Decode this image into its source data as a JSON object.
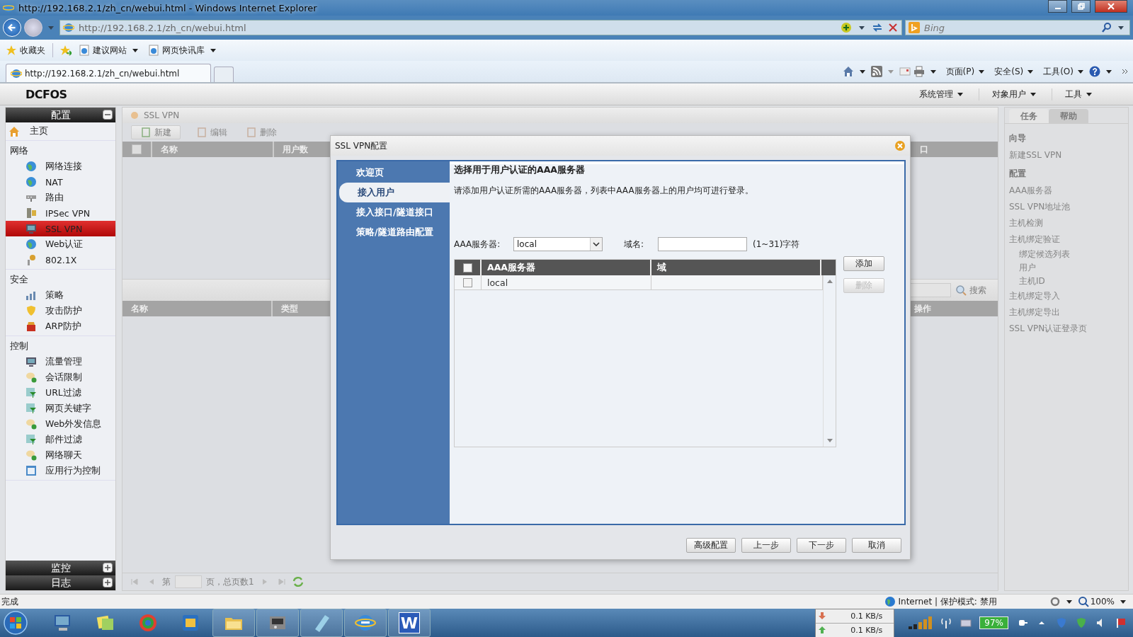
{
  "window": {
    "title": "http://192.168.2.1/zh_cn/webui.html - Windows Internet Explorer"
  },
  "address_bar": {
    "url": "http://192.168.2.1/zh_cn/webui.html"
  },
  "search_box": {
    "placeholder": "Bing"
  },
  "favorites_bar": {
    "items": [
      {
        "label": "收藏夹",
        "kind": "star"
      },
      {
        "label": "建议网站",
        "kind": "dropdown"
      },
      {
        "label": "网页快讯库",
        "kind": "dropdown"
      }
    ]
  },
  "browser_tabs": [
    {
      "label": "http://192.168.2.1/zh_cn/webui.html",
      "selected": true
    }
  ],
  "command_bar": {
    "menus": [
      "页面(P)",
      "安全(S)",
      "工具(O)"
    ]
  },
  "app": {
    "logo": "DCFOS",
    "menus": [
      "系统管理",
      "对象用户",
      "工具"
    ]
  },
  "sidebar": {
    "config_panel": {
      "title": "配置",
      "expanded": true,
      "home": {
        "label": "主页",
        "selected": false
      },
      "groups": [
        {
          "title": "网络",
          "items": [
            {
              "label": "网络连接",
              "selected": false
            },
            {
              "label": "NAT",
              "selected": false
            },
            {
              "label": "路由",
              "selected": false
            },
            {
              "label": "IPSec VPN",
              "selected": false
            },
            {
              "label": "SSL VPN",
              "selected": true
            },
            {
              "label": "Web认证",
              "selected": false
            },
            {
              "label": "802.1X",
              "selected": false
            }
          ]
        },
        {
          "title": "安全",
          "items": [
            {
              "label": "策略",
              "selected": false
            },
            {
              "label": "攻击防护",
              "selected": false
            },
            {
              "label": "ARP防护",
              "selected": false
            }
          ]
        },
        {
          "title": "控制",
          "items": [
            {
              "label": "流量管理",
              "selected": false
            },
            {
              "label": "会话限制",
              "selected": false
            },
            {
              "label": "URL过滤",
              "selected": false
            },
            {
              "label": "网页关键字",
              "selected": false
            },
            {
              "label": "Web外发信息",
              "selected": false
            },
            {
              "label": "邮件过滤",
              "selected": false
            },
            {
              "label": "网络聊天",
              "selected": false
            },
            {
              "label": "应用行为控制",
              "selected": false
            }
          ]
        }
      ]
    },
    "collapsed_panels": [
      {
        "title": "监控",
        "expanded": false
      },
      {
        "title": "日志",
        "expanded": false
      }
    ]
  },
  "content": {
    "title": "SSL VPN",
    "toolbar": [
      {
        "label": "新建",
        "disabled": false
      },
      {
        "label": "编辑",
        "disabled": true
      },
      {
        "label": "删除",
        "disabled": true
      }
    ],
    "table_1": {
      "all_checked": false,
      "columns": [
        "名称",
        "用户数",
        "口"
      ]
    },
    "search_button": "搜索",
    "table_2": {
      "columns": [
        "名称",
        "类型",
        "操作"
      ]
    },
    "pager": {
      "before": "第",
      "after": "页，总页数1"
    }
  },
  "task_panel": {
    "tabs": [
      {
        "label": "任务",
        "selected": true
      },
      {
        "label": "帮助",
        "selected": false
      }
    ],
    "sections": [
      {
        "title": "向导",
        "items": [
          {
            "label": "新建SSL VPN"
          }
        ]
      },
      {
        "title": "配置",
        "items": [
          {
            "label": "AAA服务器"
          },
          {
            "label": "SSL VPN地址池"
          },
          {
            "label": "主机检测"
          },
          {
            "label": "主机绑定验证",
            "children": [
              {
                "label": "绑定候选列表"
              },
              {
                "label": "用户"
              },
              {
                "label": "主机ID"
              }
            ]
          },
          {
            "label": "主机绑定导入"
          },
          {
            "label": "主机绑定导出"
          },
          {
            "label": "SSL VPN认证登录页"
          }
        ]
      }
    ]
  },
  "dialog": {
    "title": "SSL VPN配置",
    "steps": [
      {
        "label": "欢迎页",
        "selected": false
      },
      {
        "label": "接入用户",
        "selected": true
      },
      {
        "label": "接入接口/隧道接口",
        "selected": false
      },
      {
        "label": "策略/隧道路由配置",
        "selected": false
      }
    ],
    "heading": "选择用于用户认证的AAA服务器",
    "description": "请添加用户认证所需的AAA服务器，列表中AAA服务器上的用户均可进行登录。",
    "server_field": {
      "label": "AAA服务器:",
      "value": "local"
    },
    "domain_field": {
      "label": "域名:",
      "hint": "(1~31)字符"
    },
    "side_buttons": [
      {
        "label": "添加",
        "disabled": false
      },
      {
        "label": "删除",
        "disabled": true
      }
    ],
    "table": {
      "all_checked": false,
      "columns": [
        "AAA服务器",
        "域"
      ],
      "rows": [
        {
          "checked": false,
          "cells": [
            "local"
          ]
        }
      ]
    },
    "buttons": [
      "高级配置",
      "上一步",
      "下一步",
      "取消"
    ]
  },
  "status_bar": {
    "text": "完成",
    "zone": "Internet | 保护模式: 禁用",
    "zoom": "100%"
  },
  "taskbar": {
    "letter_tile": "W",
    "network_speeds": [
      "0.1 KB/s",
      "0.1 KB/s"
    ],
    "battery": "97%"
  }
}
